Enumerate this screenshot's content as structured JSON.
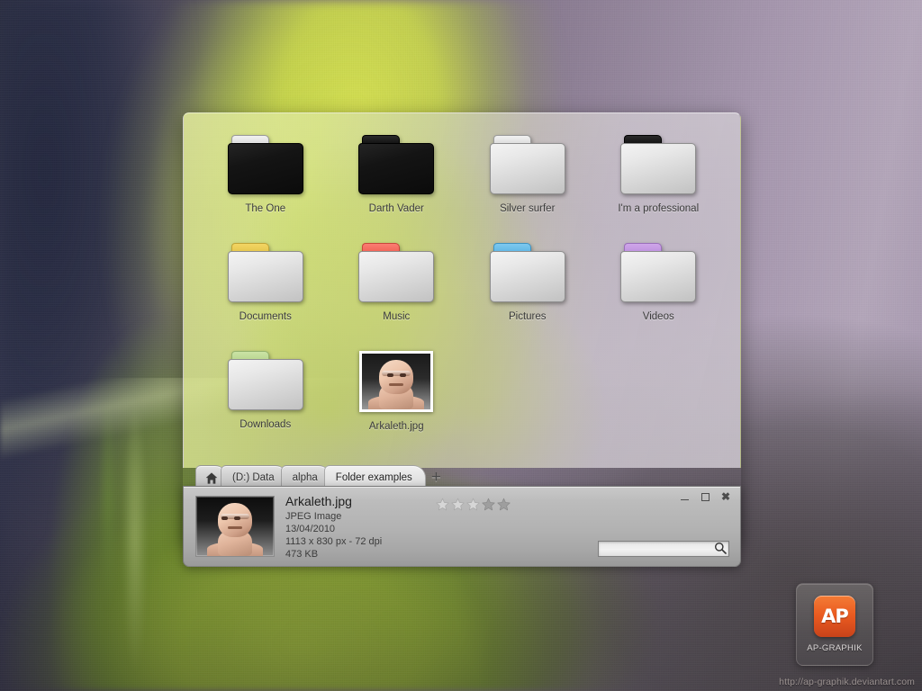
{
  "desktop": {
    "wallpaper_colors": {
      "navy": "#2c2f42",
      "green": "#cbda4a",
      "purple": "#a596ad",
      "leaf_green": "#a0c036"
    },
    "site_url": "http://ap-graphik.deviantart.com"
  },
  "file_manager": {
    "icons": [
      {
        "label": "The One",
        "type": "folder",
        "body": "black",
        "tab": "silver"
      },
      {
        "label": "Darth Vader",
        "type": "folder",
        "body": "black",
        "tab": "black"
      },
      {
        "label": "Silver surfer",
        "type": "folder",
        "body": "silver",
        "tab": "silver"
      },
      {
        "label": "I'm a professional",
        "type": "folder",
        "body": "silver",
        "tab": "black"
      },
      {
        "label": "Documents",
        "type": "folder",
        "body": "silver",
        "tab": "yellow"
      },
      {
        "label": "Music",
        "type": "folder",
        "body": "silver",
        "tab": "red"
      },
      {
        "label": "Pictures",
        "type": "folder",
        "body": "silver",
        "tab": "blue"
      },
      {
        "label": "Videos",
        "type": "folder",
        "body": "silver",
        "tab": "purple"
      },
      {
        "label": "Downloads",
        "type": "folder",
        "body": "silver",
        "tab": "green"
      },
      {
        "label": "Arkaleth.jpg",
        "type": "image",
        "body": "",
        "tab": ""
      }
    ],
    "tabs": {
      "home_icon": "home-icon",
      "items": [
        {
          "label": "(D:) Data",
          "active": false
        },
        {
          "label": "alpha",
          "active": false
        },
        {
          "label": "Folder examples",
          "active": true
        }
      ],
      "add_label": "+"
    },
    "detail": {
      "name": "Arkaleth.jpg",
      "kind": "JPEG Image",
      "date": "13/04/2010",
      "dimensions": "1113 x 830 px - 72 dpi",
      "size": "473 KB",
      "rating": {
        "value": 0,
        "max": 5
      }
    },
    "search": {
      "value": "",
      "placeholder": ""
    },
    "window_controls": {
      "minimize": "minimize-icon",
      "maximize": "maximize-icon",
      "close": "✖"
    }
  },
  "ap_widget": {
    "logo_text": "AP",
    "label": "AP-GRAPHIK",
    "accent": "#ea5a20"
  }
}
